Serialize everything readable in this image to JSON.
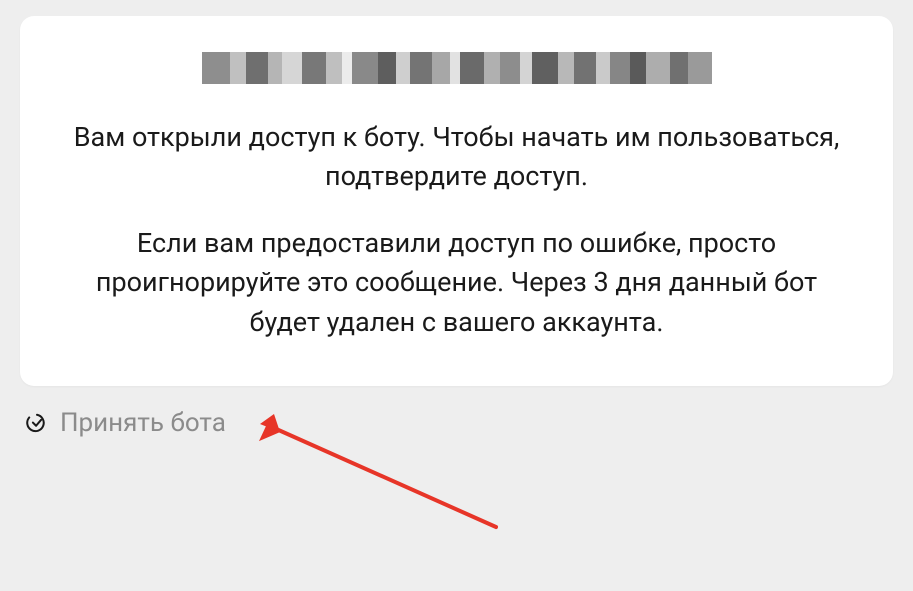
{
  "card": {
    "title_redacted": true,
    "paragraph1": "Вам открыли доступ к боту. Чтобы начать им пользоваться, подтвердите доступ.",
    "paragraph2": "Если вам предоставили доступ по ошибке, просто проигнорируйте это сообщение. Через 3 дня данный бот будет удален с вашего аккаунта."
  },
  "action": {
    "accept_label": "Принять бота"
  },
  "annotation": {
    "arrow_color": "#e73528"
  }
}
